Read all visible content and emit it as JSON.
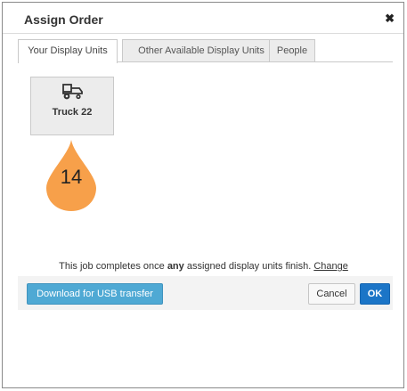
{
  "dialog": {
    "title": "Assign Order",
    "close_glyph": "✖"
  },
  "tabs": [
    {
      "label": "Your Display Units",
      "active": true
    },
    {
      "label": "Other Available Display Units",
      "active": false
    },
    {
      "label": "People",
      "active": false
    }
  ],
  "units": [
    {
      "name": "Truck 22",
      "icon": "truck-icon"
    }
  ],
  "marker": {
    "label": "14",
    "icon": "drop-marker-icon",
    "color": "#f7a04a"
  },
  "completion_note": {
    "before": "This job completes once ",
    "emphasis": "any",
    "after": " assigned display units finish. ",
    "link": "Change"
  },
  "footer": {
    "usb_label": "Download for USB transfer",
    "cancel_label": "Cancel",
    "ok_label": "OK"
  },
  "colors": {
    "primary": "#1b75c7",
    "info": "#4fa9d4"
  }
}
